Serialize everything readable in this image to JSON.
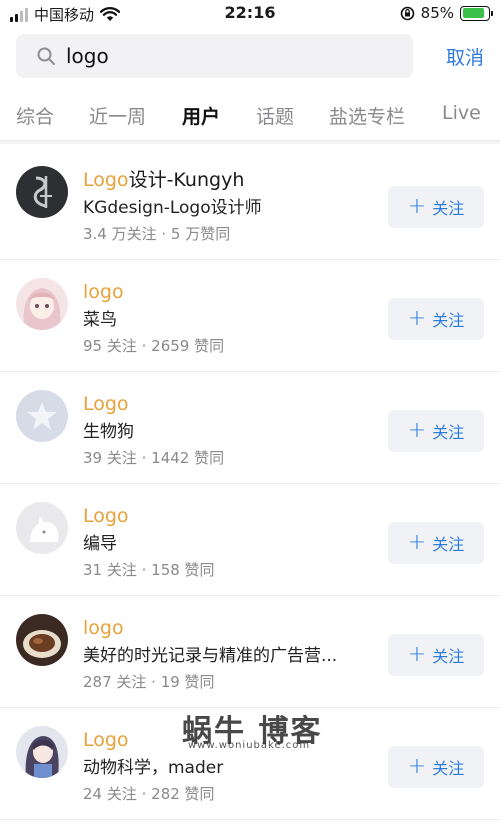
{
  "status_bar": {
    "carrier": "中国移动",
    "time": "22:16",
    "battery": "85%",
    "battery_level": 0.85
  },
  "search": {
    "query": "logo",
    "cancel_label": "取消"
  },
  "tabs": [
    {
      "label": "综合"
    },
    {
      "label": "近一周"
    },
    {
      "label": "用户"
    },
    {
      "label": "话题"
    },
    {
      "label": "盐选专栏"
    },
    {
      "label": "Live"
    }
  ],
  "active_tab": "用户",
  "follow_label": "关注",
  "results": [
    {
      "name_highlight": "Logo",
      "name_rest": "设计-Kungyh",
      "bio": "KGdesign-Logo设计师",
      "stats": "3.4 万关注 · 5 万赞同"
    },
    {
      "name_highlight": "logo",
      "name_rest": "",
      "bio": "菜鸟",
      "stats": "95 关注 · 2659 赞同"
    },
    {
      "name_highlight": "Logo",
      "name_rest": "",
      "bio": "生物狗",
      "stats": "39 关注 · 1442 赞同"
    },
    {
      "name_highlight": "Logo",
      "name_rest": "",
      "bio": "编导",
      "stats": "31 关注 · 158 赞同"
    },
    {
      "name_highlight": "logo",
      "name_rest": "",
      "bio": "美好的时光记录与精准的广告营...",
      "stats": "287 关注 · 19 赞同"
    },
    {
      "name_highlight": "Logo",
      "name_rest": "",
      "bio": "动物科学，mader",
      "stats": "24 关注 · 282 赞同"
    }
  ],
  "watermark": {
    "main": "蜗牛 博客",
    "sub": "www.woniubake.com"
  },
  "colors": {
    "accent_blue": "#2f7ce0",
    "highlight_orange": "#e8a23a",
    "battery_green": "#3cc14a"
  }
}
